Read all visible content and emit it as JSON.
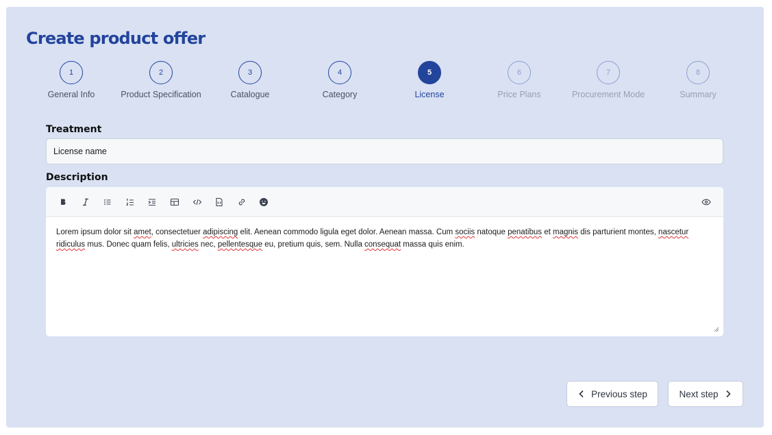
{
  "page": {
    "title": "Create product offer"
  },
  "stepper": {
    "steps": [
      {
        "number": "1",
        "label": "General Info",
        "state": "done"
      },
      {
        "number": "2",
        "label": "Product Specification",
        "state": "done"
      },
      {
        "number": "3",
        "label": "Catalogue",
        "state": "done"
      },
      {
        "number": "4",
        "label": "Category",
        "state": "done"
      },
      {
        "number": "5",
        "label": "License",
        "state": "active"
      },
      {
        "number": "6",
        "label": "Price Plans",
        "state": "future"
      },
      {
        "number": "7",
        "label": "Procurement Mode",
        "state": "future"
      },
      {
        "number": "8",
        "label": "Summary",
        "state": "future"
      }
    ]
  },
  "treatment": {
    "label": "Treatment",
    "value": "License name"
  },
  "description": {
    "label": "Description",
    "toolbar": [
      "bold-icon",
      "italic-icon",
      "bullet-list-icon",
      "numbered-list-icon",
      "indent-icon",
      "table-icon",
      "code-icon",
      "file-code-icon",
      "link-icon",
      "emoji-icon"
    ],
    "preview_icon": "eye-icon",
    "segments": [
      "Lorem ipsum dolor sit ",
      "amet",
      ", consectetuer ",
      "adipiscing",
      " elit. Aenean commodo ligula eget dolor. Aenean massa. Cum ",
      "sociis",
      " natoque ",
      "penatibus",
      " et ",
      "magnis",
      " dis parturient montes, ",
      "nascetur",
      " ",
      "ridiculus",
      " mus. Donec quam felis, ",
      "ultricies",
      " nec, ",
      "pellentesque",
      " eu, pretium quis, sem. Nulla ",
      "consequat",
      " massa quis enim."
    ]
  },
  "actions": {
    "previous_label": "Previous step",
    "next_label": "Next step"
  },
  "colors": {
    "primary": "#23449b",
    "panel": "#d9e1f3",
    "muted_step": "#8ea0cd",
    "spellcheck": "#e03131"
  }
}
